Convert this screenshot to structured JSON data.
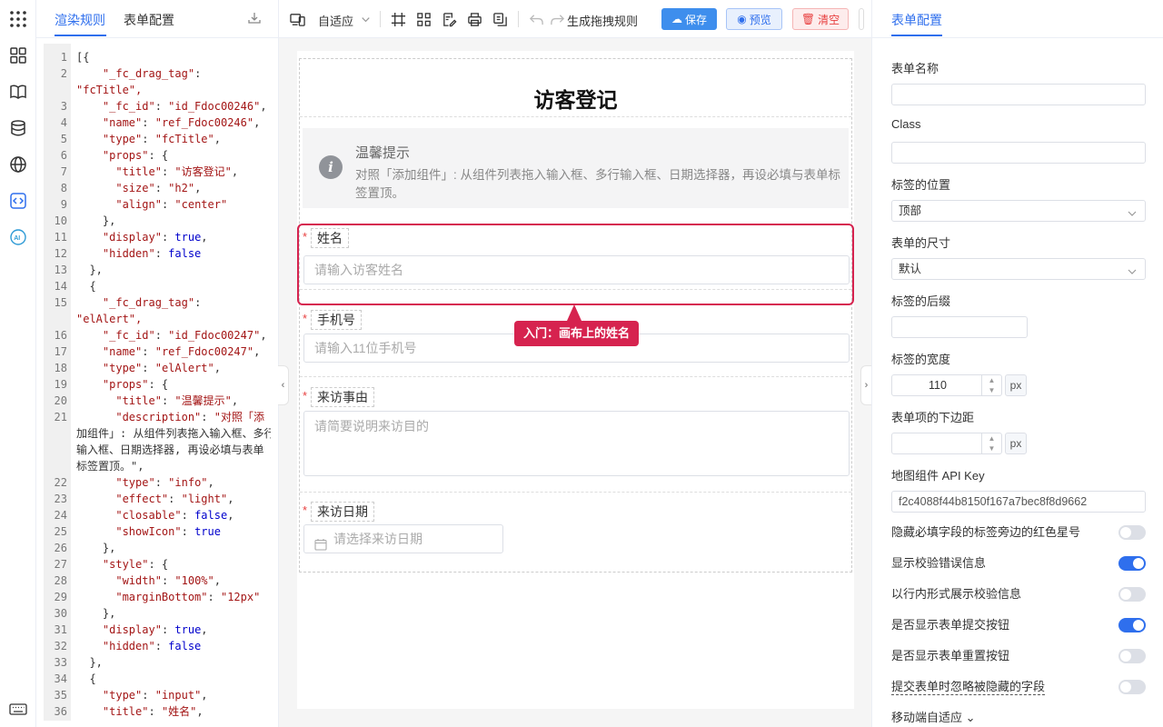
{
  "code_panel": {
    "tabs": [
      "渲染规则",
      "表单配置"
    ],
    "lines": [
      {
        "n": "1",
        "t": "[{"
      },
      {
        "n": "2",
        "t": "    \"_fc_drag_tag\":"
      },
      {
        "n": "",
        "t": "\"fcTitle\","
      },
      {
        "n": "3",
        "t": "    \"_fc_id\": \"id_Fdoc00246\","
      },
      {
        "n": "4",
        "t": "    \"name\": \"ref_Fdoc00246\","
      },
      {
        "n": "5",
        "t": "    \"type\": \"fcTitle\","
      },
      {
        "n": "6",
        "t": "    \"props\": {"
      },
      {
        "n": "7",
        "t": "      \"title\": \"访客登记\","
      },
      {
        "n": "8",
        "t": "      \"size\": \"h2\","
      },
      {
        "n": "9",
        "t": "      \"align\": \"center\""
      },
      {
        "n": "10",
        "t": "    },"
      },
      {
        "n": "11",
        "t": "    \"display\": true,"
      },
      {
        "n": "12",
        "t": "    \"hidden\": false"
      },
      {
        "n": "13",
        "t": "  },"
      },
      {
        "n": "14",
        "t": "  {"
      },
      {
        "n": "15",
        "t": "    \"_fc_drag_tag\":"
      },
      {
        "n": "",
        "t": "\"elAlert\","
      },
      {
        "n": "16",
        "t": "    \"_fc_id\": \"id_Fdoc00247\","
      },
      {
        "n": "17",
        "t": "    \"name\": \"ref_Fdoc00247\","
      },
      {
        "n": "18",
        "t": "    \"type\": \"elAlert\","
      },
      {
        "n": "19",
        "t": "    \"props\": {"
      },
      {
        "n": "20",
        "t": "      \"title\": \"温馨提示\","
      },
      {
        "n": "21",
        "t": "      \"description\": \"对照「添"
      },
      {
        "n": "",
        "t": "加组件」: 从组件列表拖入输入框、多行"
      },
      {
        "n": "",
        "t": "输入框、日期选择器, 再设必填与表单"
      },
      {
        "n": "",
        "t": "标签置顶。\","
      },
      {
        "n": "22",
        "t": "      \"type\": \"info\","
      },
      {
        "n": "23",
        "t": "      \"effect\": \"light\","
      },
      {
        "n": "24",
        "t": "      \"closable\": false,"
      },
      {
        "n": "25",
        "t": "      \"showIcon\": true"
      },
      {
        "n": "26",
        "t": "    },"
      },
      {
        "n": "27",
        "t": "    \"style\": {"
      },
      {
        "n": "28",
        "t": "      \"width\": \"100%\","
      },
      {
        "n": "29",
        "t": "      \"marginBottom\": \"12px\""
      },
      {
        "n": "30",
        "t": "    },"
      },
      {
        "n": "31",
        "t": "    \"display\": true,"
      },
      {
        "n": "32",
        "t": "    \"hidden\": false"
      },
      {
        "n": "33",
        "t": "  },"
      },
      {
        "n": "34",
        "t": "  {"
      },
      {
        "n": "35",
        "t": "    \"type\": \"input\","
      },
      {
        "n": "36",
        "t": "    \"title\": \"姓名\","
      }
    ]
  },
  "toolbar": {
    "adapt_label": "自适应",
    "gen_rule_label": "生成拖拽规则",
    "save_label": "保存",
    "preview_label": "预览",
    "clear_label": "清空"
  },
  "canvas": {
    "form_title": "访客登记",
    "alert": {
      "title": "温馨提示",
      "description": "对照「添加组件」: 从组件列表拖入输入框、多行输入框、日期选择器，再设必填与表单标签置顶。"
    },
    "fields": [
      {
        "label": "姓名",
        "placeholder": "请输入访客姓名"
      },
      {
        "label": "手机号",
        "placeholder": "请输入11位手机号"
      },
      {
        "label": "来访事由",
        "placeholder": "请简要说明来访目的"
      },
      {
        "label": "来访日期",
        "placeholder": "请选择来访日期"
      }
    ],
    "required_mark": "*",
    "tooltip": "入门：画布上的姓名"
  },
  "config": {
    "tab": "表单配置",
    "form_name_label": "表单名称",
    "form_name_value": "",
    "class_label": "Class",
    "class_value": "",
    "label_position_label": "标签的位置",
    "label_position_value": "顶部",
    "form_size_label": "表单的尺寸",
    "form_size_value": "默认",
    "label_suffix_label": "标签的后缀",
    "label_suffix_value": "",
    "label_width_label": "标签的宽度",
    "label_width_value": "110",
    "label_width_unit": "px",
    "item_margin_label": "表单项的下边距",
    "item_margin_value": "",
    "item_margin_unit": "px",
    "map_key_label": "地图组件 API Key",
    "map_key_value": "f2c4088f44b8150f167a7bec8f8d9662",
    "switches": [
      {
        "label": "隐藏必填字段的标签旁边的红色星号",
        "on": false
      },
      {
        "label": "显示校验错误信息",
        "on": true
      },
      {
        "label": "以行内形式展示校验信息",
        "on": false
      },
      {
        "label": "是否显示表单提交按钮",
        "on": true
      },
      {
        "label": "是否显示表单重置按钮",
        "on": false
      },
      {
        "label": "提交表单时忽略被隐藏的字段",
        "on": false
      }
    ],
    "mobile_label": "移动端自适应"
  },
  "colors": {
    "accent": "#2f6fed",
    "highlight": "#d6234f",
    "danger": "#e84040"
  }
}
